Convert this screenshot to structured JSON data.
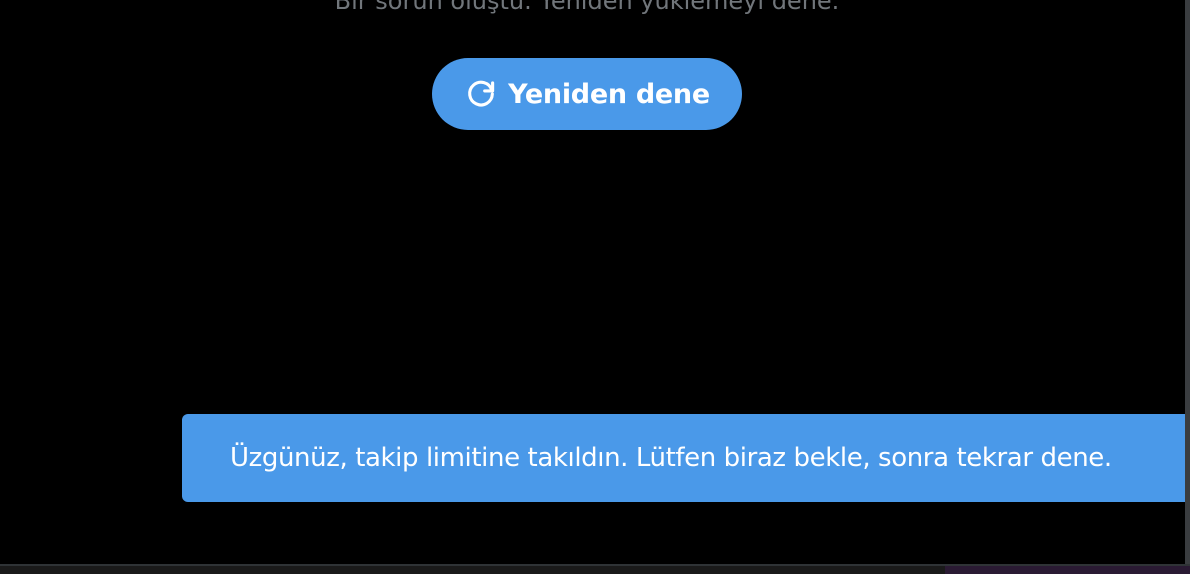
{
  "error": {
    "message": "Bir sorun oluştu. Yeniden yüklemeyi dene."
  },
  "retry_button": {
    "label": "Yeniden dene",
    "icon": "refresh-icon"
  },
  "toast": {
    "text": "Üzgünüz, takip limitine takıldın. Lütfen biraz bekle, sonra tekrar dene."
  },
  "colors": {
    "background": "#000000",
    "accent": "#4a99e9",
    "secondary_text": "#71767b",
    "text_on_accent": "#ffffff"
  }
}
